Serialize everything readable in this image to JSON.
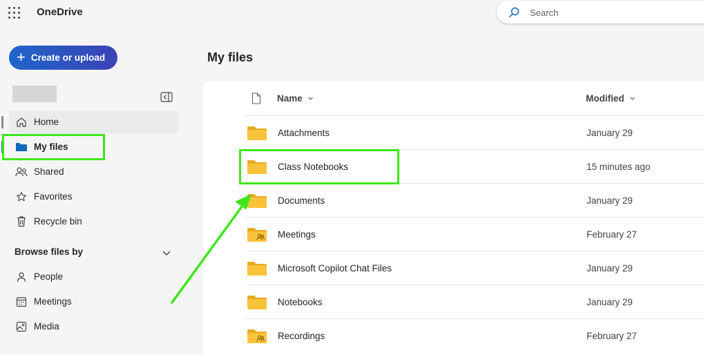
{
  "app": {
    "title": "OneDrive"
  },
  "search": {
    "placeholder": "Search"
  },
  "create_button": {
    "label": "Create or upload"
  },
  "nav": {
    "items": [
      {
        "label": "Home",
        "icon": "home-icon"
      },
      {
        "label": "My files",
        "icon": "folder-icon"
      },
      {
        "label": "Shared",
        "icon": "people-icon"
      },
      {
        "label": "Favorites",
        "icon": "star-icon"
      },
      {
        "label": "Recycle bin",
        "icon": "trash-icon"
      }
    ],
    "browse_header": "Browse files by",
    "browse_items": [
      {
        "label": "People",
        "icon": "person-icon"
      },
      {
        "label": "Meetings",
        "icon": "calendar-icon"
      },
      {
        "label": "Media",
        "icon": "image-icon"
      }
    ]
  },
  "main": {
    "title": "My files",
    "columns": {
      "name": "Name",
      "modified": "Modified"
    },
    "rows": [
      {
        "name": "Attachments",
        "modified": "January 29",
        "shared": false
      },
      {
        "name": "Class Notebooks",
        "modified": "15 minutes ago",
        "shared": false
      },
      {
        "name": "Documents",
        "modified": "January 29",
        "shared": false
      },
      {
        "name": "Meetings",
        "modified": "February 27",
        "shared": true
      },
      {
        "name": "Microsoft Copilot Chat Files",
        "modified": "January 29",
        "shared": false
      },
      {
        "name": "Notebooks",
        "modified": "January 29",
        "shared": false
      },
      {
        "name": "Recordings",
        "modified": "February 27",
        "shared": true
      }
    ]
  },
  "colors": {
    "accent": "#0f6cbd",
    "highlight": "#3fe51a",
    "folder": "#f8c33a"
  }
}
